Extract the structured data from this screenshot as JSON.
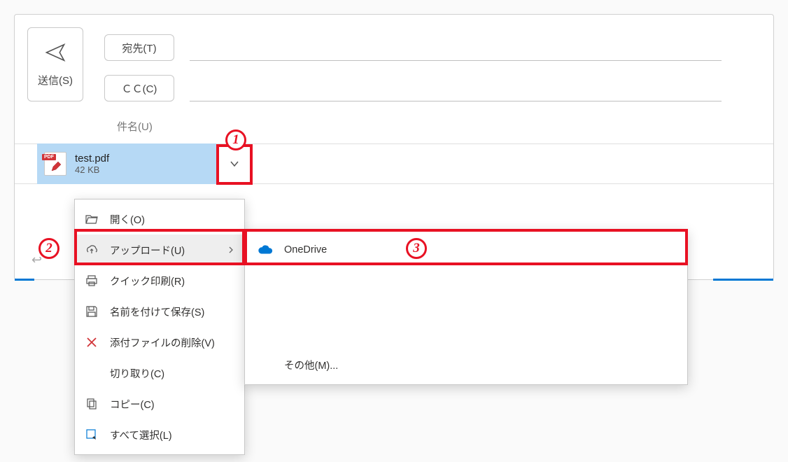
{
  "compose": {
    "send_label": "送信(S)",
    "to_label": "宛先(T)",
    "cc_label": "ＣＣ(C)",
    "subject_label": "件名(U)"
  },
  "attachment": {
    "badge": "PDF",
    "name": "test.pdf",
    "size": "42 KB"
  },
  "menu": {
    "open": "開く(O)",
    "upload": "アップロード(U)",
    "quick_print": "クイック印刷(R)",
    "save_as": "名前を付けて保存(S)",
    "remove": "添付ファイルの削除(V)",
    "cut": "切り取り(C)",
    "copy": "コピー(C)",
    "select_all": "すべて選択(L)"
  },
  "submenu": {
    "onedrive": "OneDrive",
    "other": "その他(M)..."
  },
  "callouts": {
    "one": "1",
    "two": "2",
    "three": "3"
  }
}
